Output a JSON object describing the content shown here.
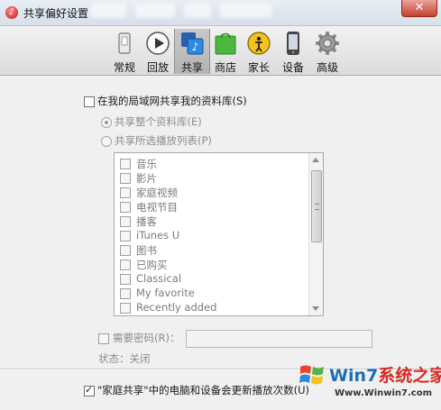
{
  "window": {
    "title": "共享偏好设置",
    "close_label": "✕"
  },
  "toolbar": {
    "items": [
      {
        "label": "常规",
        "icon": "general-switch-icon"
      },
      {
        "label": "回放",
        "icon": "playback-icon"
      },
      {
        "label": "共享",
        "icon": "sharing-icon",
        "active": true
      },
      {
        "label": "商店",
        "icon": "store-bag-icon"
      },
      {
        "label": "家长",
        "icon": "parental-icon"
      },
      {
        "label": "设备",
        "icon": "device-iphone-icon"
      },
      {
        "label": "高级",
        "icon": "advanced-gear-icon"
      }
    ]
  },
  "sharing": {
    "share_library_label": "在我的局域网共享我的资料库(S)",
    "share_library_checked": false,
    "share_entire_label": "共享整个资料库(E)",
    "share_selected_label": "共享所选播放列表(P)",
    "playlists": [
      "音乐",
      "影片",
      "家庭视频",
      "电视节目",
      "播客",
      "iTunes U",
      "图书",
      "已购买",
      "Classical",
      "My favorite",
      "Recently added"
    ],
    "require_password_label": "需要密码(R)：",
    "password_value": "",
    "status_label": "状态：关闭",
    "home_sharing_label": "\"家庭共享\"中的电脑和设备会更新播放次数(U)",
    "home_sharing_checked": true
  },
  "watermark": {
    "brand_text_a": "Win7",
    "brand_text_b": "系统之家",
    "url": "Www.Winwin7.com"
  },
  "colors": {
    "accent_blue": "#1f6fd0",
    "titlebar_close": "#c7402e",
    "watermark_blue": "#1d6fb5",
    "watermark_red": "#d52a22"
  }
}
